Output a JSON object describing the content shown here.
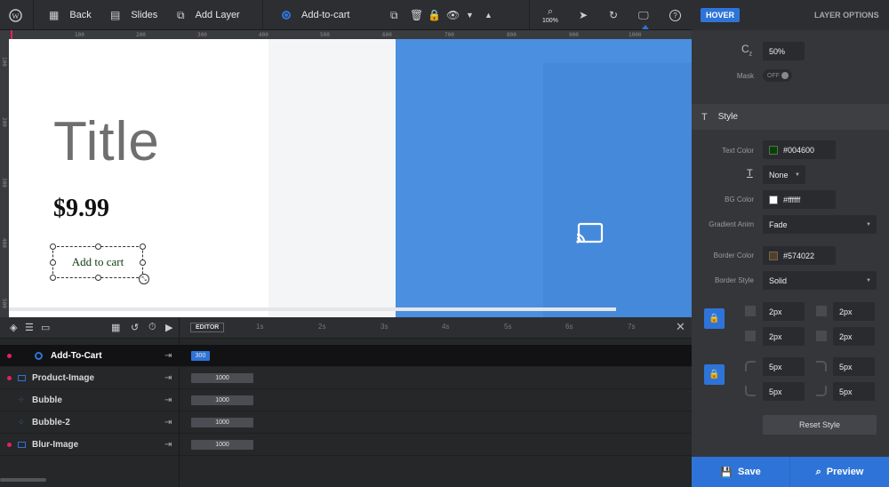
{
  "toolbar": {
    "back": "Back",
    "slides": "Slides",
    "add_layer": "Add Layer",
    "current_layer": "Add-to-cart",
    "zoom": "100%"
  },
  "ruler": {
    "h": [
      "100",
      "200",
      "300",
      "400",
      "500",
      "600",
      "700",
      "800",
      "900",
      "1000"
    ],
    "v": [
      "100",
      "200",
      "300",
      "400",
      "500"
    ]
  },
  "canvas": {
    "title": "Title",
    "price": "$9.99",
    "cart": "Add to cart"
  },
  "panel": {
    "hover_tab": "HOVER",
    "options_tab": "LAYER OPTIONS",
    "opacity": "50%",
    "mask_label": "Mask",
    "mask_toggle": "OFF",
    "style_heading": "Style",
    "text_color_label": "Text Color",
    "text_color": "#004600",
    "text_decoration": "None",
    "bg_color_label": "BG Color",
    "bg_color": "#ffffff",
    "gradient_label": "Gradient Anim",
    "gradient": "Fade",
    "border_color_label": "Border Color",
    "border_color": "#574022",
    "border_style_label": "Border Style",
    "border_style": "Solid",
    "border_widths": [
      "2px",
      "2px",
      "2px",
      "2px"
    ],
    "radii": [
      "5px",
      "5px",
      "5px",
      "5px"
    ],
    "reset": "Reset Style",
    "save": "Save",
    "preview": "Preview"
  },
  "timeline": {
    "editor_label": "EDITOR",
    "seconds": [
      "1s",
      "2s",
      "3s",
      "4s",
      "5s",
      "6s",
      "7s"
    ],
    "layers": [
      {
        "name": "Add-To-Cart",
        "duration": "300"
      },
      {
        "name": "Product-Image",
        "duration": "1000"
      },
      {
        "name": "Bubble",
        "duration": "1000"
      },
      {
        "name": "Bubble-2",
        "duration": "1000"
      },
      {
        "name": "Blur-Image",
        "duration": "1000"
      }
    ]
  },
  "colors": {
    "accent": "#2e74d8",
    "text_color_swatch": "#004600",
    "bg_color_swatch": "#ffffff",
    "border_color_swatch": "#574022"
  }
}
